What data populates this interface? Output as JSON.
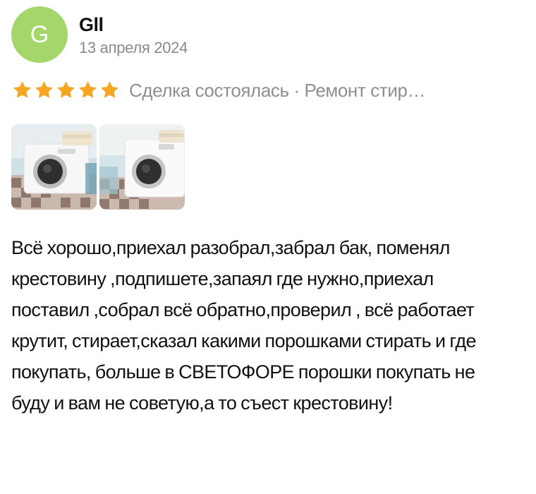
{
  "review": {
    "author": {
      "initial": "G",
      "name": "Gll",
      "avatar_color": "#a5d66c"
    },
    "date": "13 апреля 2024",
    "rating": {
      "stars": 5,
      "star_color": "#f5a623",
      "icon": "star-icon"
    },
    "deal_line": "Сделка состоялась · Ремонт стир…",
    "photos": [
      {
        "name": "washing-machine-photo-1"
      },
      {
        "name": "washing-machine-photo-2"
      }
    ],
    "text": "Всё хорошо,приехал разобрал,забрал бак, поменял крестовину ,подпишете,запаял где нужно,приехал поставил ,собрал всё обратно,проверил , всё работает крутит, стирает,сказал какими порошками стирать и где покупать, больше в СВЕТОФОРЕ порошки покупать не буду и вам не советую,а то съест крестовину!"
  }
}
